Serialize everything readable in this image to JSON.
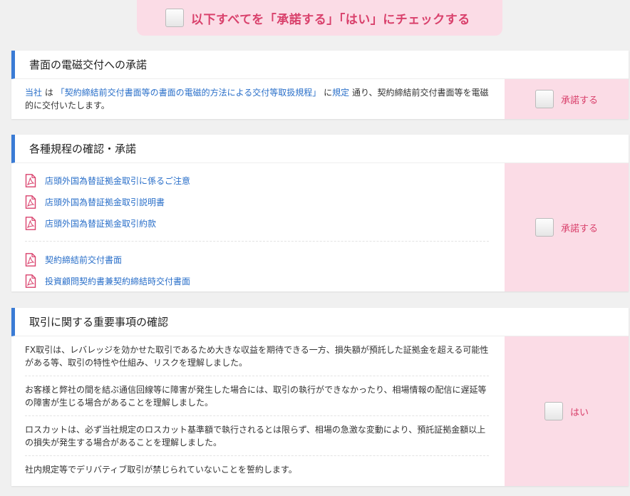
{
  "top_banner": {
    "label": "以下すべてを「承諾する」「はい」にチェックする"
  },
  "section1": {
    "title": "書面の電磁交付への承諾",
    "text_parts": {
      "company": "当社",
      "wa": " は ",
      "rule_link": "「契約締結前交付書面等の書面の電磁的方法による交付等取扱規程」",
      "ni": " に",
      "kitei": "規定",
      "rest": " 通り、契約締結前交付書面等を電磁的に交付いたします。"
    },
    "accept_label": "承諾する"
  },
  "section2": {
    "title": "各種規程の確認・承諾",
    "documents_group1": [
      {
        "label": "店頭外国為替証拠金取引に係るご注意"
      },
      {
        "label": "店頭外国為替証拠金取引説明書"
      },
      {
        "label": "店頭外国為替証拠金取引約款"
      }
    ],
    "documents_group2": [
      {
        "label": "契約締結前交付書面"
      },
      {
        "label": "投資顧問契約書兼契約締結時交付書面"
      }
    ],
    "accept_label": "承諾する"
  },
  "section3": {
    "title": "取引に関する重要事項の確認",
    "items": [
      "FX取引は、レバレッジを効かせた取引であるため大きな収益を期待できる一方、損失額が預託した証拠金を超える可能性がある等、取引の特性や仕組み、リスクを理解しました。",
      "お客様と弊社の間を結ぶ通信回線等に障害が発生した場合には、取引の執行ができなかったり、相場情報の配信に遅延等の障害が生じる場合があることを理解しました。",
      "ロスカットは、必ず当社規定のロスカット基準額で執行されるとは限らず、相場の急激な変動により、預託証拠金額以上の損失が発生する場合があることを理解しました。",
      "社内規定等でデリバティブ取引が禁じられていないことを誓約します。"
    ],
    "yes_label": "はい"
  },
  "colors": {
    "accent_pink": "#d9416c",
    "pink_bg": "#fbdce6",
    "link_blue": "#2a6fc9",
    "header_bar_blue": "#3a7bd5"
  },
  "icons": {
    "document": "pdf-icon",
    "checkbox": "checkbox"
  }
}
